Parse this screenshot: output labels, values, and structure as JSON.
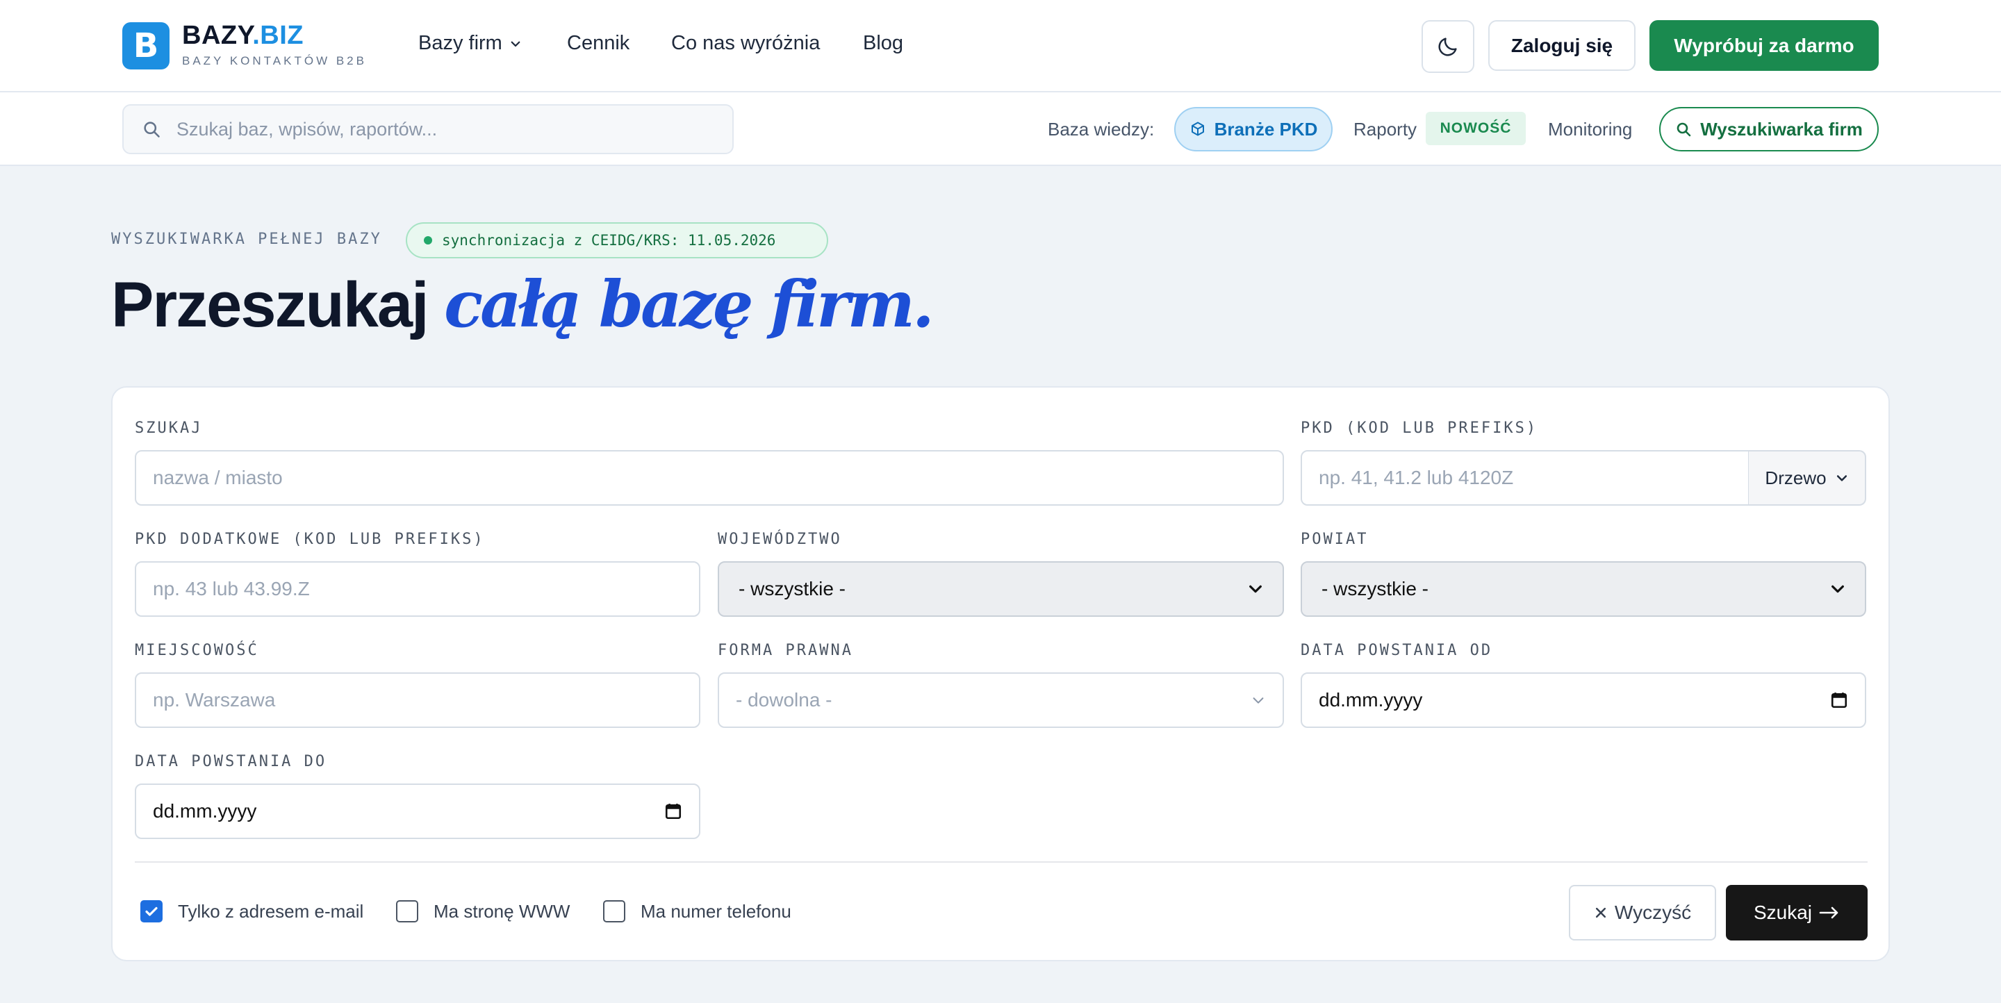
{
  "header": {
    "logo_letter": "B",
    "logo_name_main": "BAZY",
    "logo_name_accent": ".BIZ",
    "logo_tagline": "BAZY KONTAKTÓW B2B",
    "nav": [
      {
        "label": "Bazy firm",
        "has_dropdown": true
      },
      {
        "label": "Cennik"
      },
      {
        "label": "Co nas wyróżnia"
      },
      {
        "label": "Blog"
      }
    ],
    "theme_icon": "moon-icon",
    "login_label": "Zaloguj się",
    "try_label": "Wypróbuj za darmo"
  },
  "subbar": {
    "search_placeholder": "Szukaj baz, wpisów, raportów...",
    "kb_label": "Baza wiedzy:",
    "pkd_label": "Branże PKD",
    "raporty_label": "Raporty",
    "new_badge": "NOWOŚĆ",
    "monitoring_label": "Monitoring",
    "finder_label": "Wyszukiwarka firm"
  },
  "hero": {
    "eyebrow": "WYSZUKIWARKA PEŁNEJ BAZY",
    "sync_text": "synchronizacja z CEIDG/KRS: 11.05.2026",
    "title_plain": "Przeszukaj ",
    "title_script": "całą bazę firm."
  },
  "form": {
    "search": {
      "label": "SZUKAJ",
      "placeholder": "nazwa / miasto"
    },
    "pkd": {
      "label": "PKD (KOD LUB PREFIKS)",
      "placeholder": "np. 41, 41.2 lub 4120Z",
      "tree_label": "Drzewo"
    },
    "pkd_extra": {
      "label": "PKD DODATKOWE (KOD LUB PREFIKS)",
      "placeholder": "np. 43 lub 43.99.Z"
    },
    "voivodeship": {
      "label": "WOJEWÓDZTWO",
      "value": "- wszystkie -"
    },
    "county": {
      "label": "POWIAT",
      "value": "- wszystkie -"
    },
    "city": {
      "label": "MIEJSCOWOŚĆ",
      "placeholder": "np. Warszawa"
    },
    "legal_form": {
      "label": "FORMA PRAWNA",
      "value": "- dowolna -"
    },
    "date_from": {
      "label": "DATA POWSTANIA OD",
      "value": "dd.mm.yyyy"
    },
    "date_to": {
      "label": "DATA POWSTANIA DO",
      "value": "dd.mm.yyyy"
    },
    "checkboxes": [
      {
        "label": "Tylko z adresem e-mail",
        "checked": true
      },
      {
        "label": "Ma stronę WWW",
        "checked": false
      },
      {
        "label": "Ma numer telefonu",
        "checked": false
      }
    ],
    "clear_label": "Wyczyść",
    "search_label": "Szukaj"
  },
  "colors": {
    "brand_blue": "#1d8fe1",
    "brand_green": "#1a8a4f",
    "script_blue": "#1d4fd6",
    "dark_button": "#171717"
  }
}
